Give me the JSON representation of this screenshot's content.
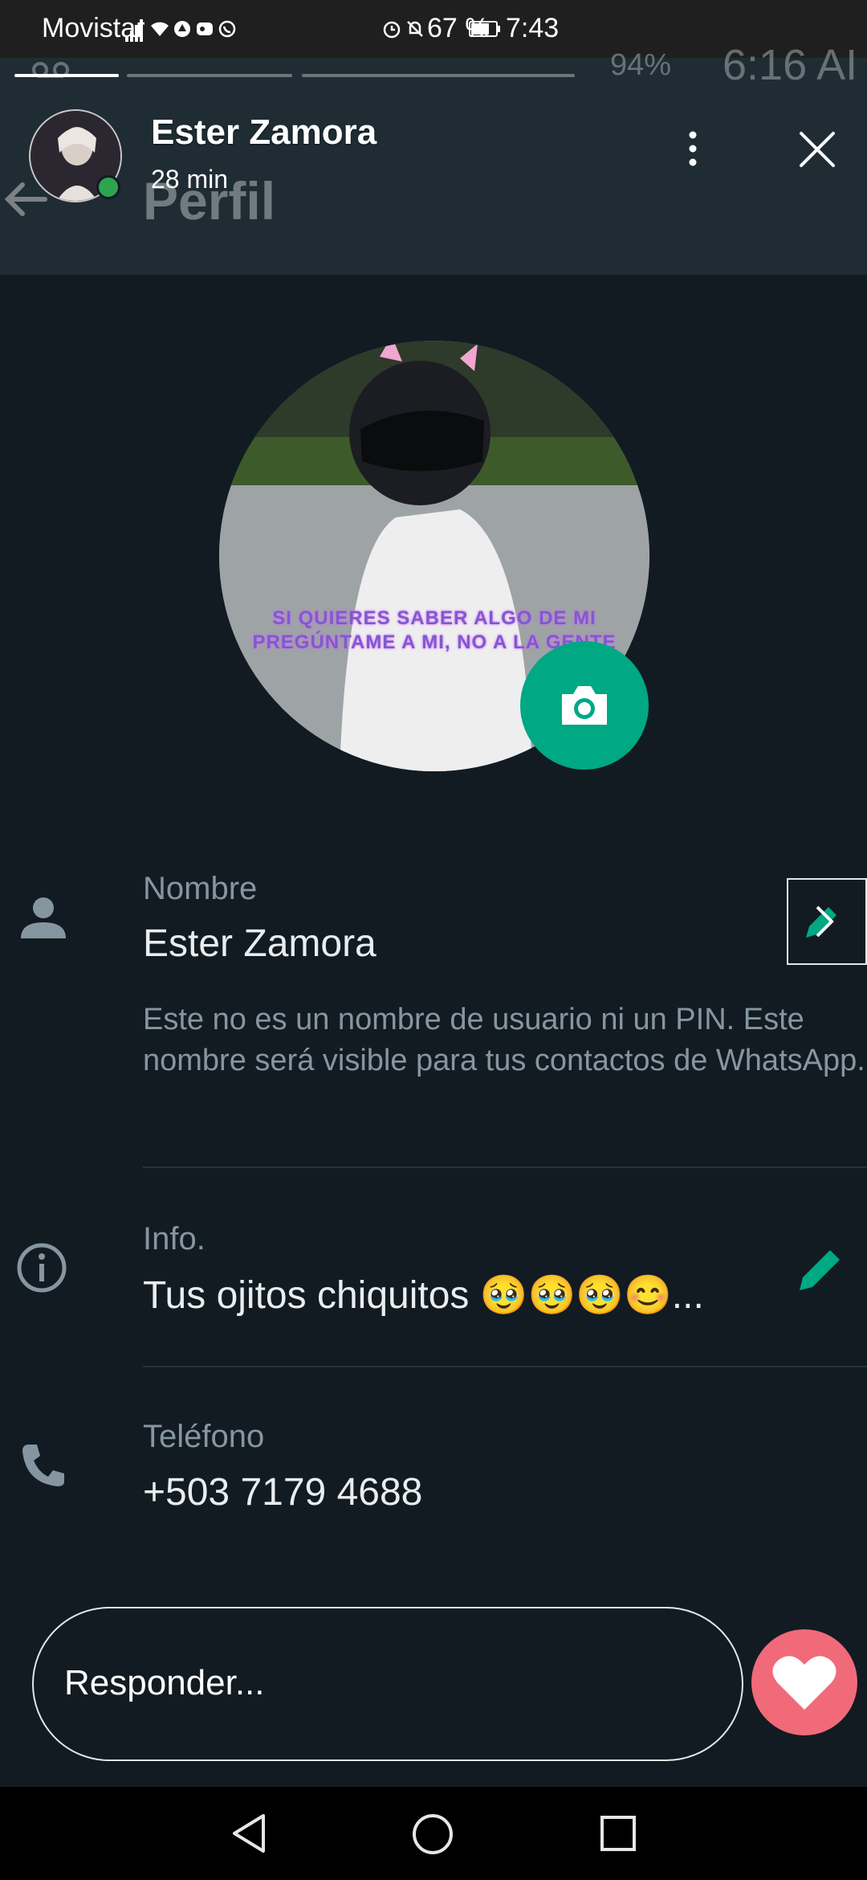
{
  "status_bar": {
    "carrier": "Movistar",
    "battery": "67 %",
    "time": "7:43",
    "icons": [
      "signal-icon",
      "wifi-icon",
      "app-icon",
      "messenger-icon",
      "whatsapp-icon",
      "alarm-icon",
      "mute-icon",
      "battery-icon"
    ]
  },
  "ghost_status": {
    "battery": "94%",
    "time": "6:16 AI"
  },
  "story": {
    "name": "Ester Zamora",
    "time_ago": "28 min"
  },
  "header": {
    "title": "Perfil"
  },
  "profile_picture": {
    "caption_line1": "SI QUIERES SABER ALGO DE MI",
    "caption_line2": "PREGÚNTAME A MI, NO A LA GENTE"
  },
  "rows": {
    "name": {
      "label": "Nombre",
      "value": "Ester Zamora",
      "hint": "Este no es un nombre de usuario ni un PIN. Este nombre será visible para tus contactos de WhatsApp."
    },
    "info": {
      "label": "Info.",
      "value": "Tus ojitos chiquitos 🥹🥹🥹😊..."
    },
    "phone": {
      "label": "Teléfono",
      "value": "+503 7179 4688"
    }
  },
  "reply": {
    "placeholder": "Responder..."
  },
  "colors": {
    "background": "#121b22",
    "accent": "#00a884",
    "like": "#f06a7a"
  }
}
